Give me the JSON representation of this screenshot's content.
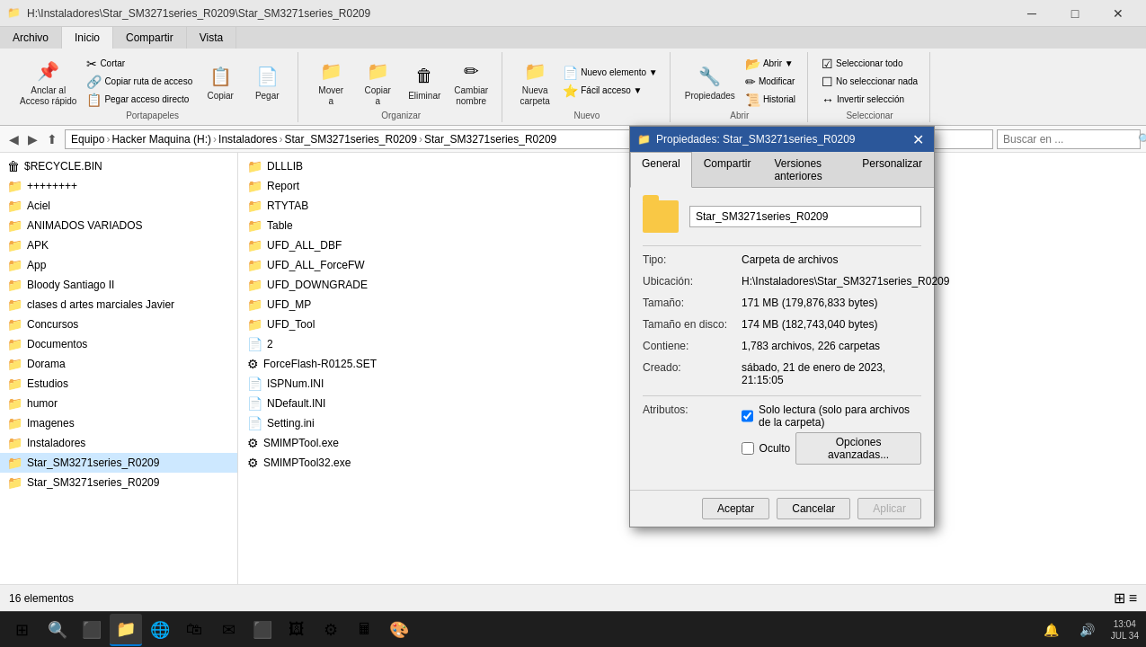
{
  "titleBar": {
    "text": "H:\\Instaladores\\Star_SM3271series_R0209\\Star_SM3271series_R0209",
    "minBtn": "─",
    "maxBtn": "□",
    "closeBtn": "✕"
  },
  "ribbon": {
    "tabs": [
      "Archivo",
      "Inicio",
      "Compartir",
      "Vista"
    ],
    "activeTab": "Inicio",
    "groups": {
      "portapapeles": {
        "label": "Portapapeles",
        "buttons": [
          {
            "icon": "📌",
            "label": "Anclar al\nAcceso rápido"
          },
          {
            "icon": "📋",
            "label": "Copiar"
          },
          {
            "icon": "📄",
            "label": "Pegar"
          },
          {
            "subItems": [
              "Cortar",
              "Copiar ruta de acceso",
              "Pegar acceso directo"
            ]
          }
        ]
      },
      "organizar": {
        "label": "Organizar",
        "buttons": [
          {
            "icon": "📁",
            "label": "Mover\na"
          },
          {
            "icon": "📁",
            "label": "Copiar\na"
          },
          {
            "icon": "🗑",
            "label": "Eliminar"
          },
          {
            "icon": "✏",
            "label": "Cambiar\nnombre"
          }
        ]
      },
      "nuevo": {
        "label": "Nuevo",
        "buttons": [
          {
            "icon": "📁",
            "label": "Nueva\ncarpeta"
          },
          {
            "icon": "📄",
            "label": "Nuevo elemento ▼"
          },
          {
            "icon": "⭐",
            "label": "Fácil acceso ▼"
          }
        ]
      },
      "abrir": {
        "label": "Abrir",
        "buttons": [
          {
            "icon": "📂",
            "label": "Abrir ▼"
          },
          {
            "icon": "✏",
            "label": "Modificar"
          },
          {
            "icon": "📜",
            "label": "Historial"
          },
          {
            "icon": "🔧",
            "label": "Propiedades"
          }
        ]
      },
      "seleccionar": {
        "label": "Seleccionar",
        "buttons": [
          {
            "icon": "☑",
            "label": "Seleccionar todo"
          },
          {
            "icon": "☐",
            "label": "No seleccionar nada"
          },
          {
            "icon": "↔",
            "label": "Invertir selección"
          }
        ]
      }
    }
  },
  "breadcrumb": {
    "backBtn": "◀",
    "forwardBtn": "▶",
    "upBtn": "⬆",
    "path": [
      "Equipo",
      "Hacker Maquina (H:)",
      "Instaladores",
      "Star_SM3271series_R0209",
      "Star_SM3271series_R0209"
    ],
    "searchPlaceholder": "Buscar en ..."
  },
  "sidebar": {
    "items": [
      {
        "label": "$RECYCLE.BIN",
        "type": "folder",
        "icon": "🗑"
      },
      {
        "label": "++++++++",
        "type": "folder",
        "icon": "📁"
      },
      {
        "label": "Aciel",
        "type": "folder",
        "icon": "📁"
      },
      {
        "label": "ANIMADOS VARIADOS",
        "type": "folder",
        "icon": "📁"
      },
      {
        "label": "APK",
        "type": "folder",
        "icon": "📁"
      },
      {
        "label": "App",
        "type": "folder",
        "icon": "📁"
      },
      {
        "label": "Bloody Santiago II",
        "type": "folder",
        "icon": "📁"
      },
      {
        "label": "clases d artes marciales Javier",
        "type": "folder",
        "icon": "📁"
      },
      {
        "label": "Concursos",
        "type": "folder",
        "icon": "📁"
      },
      {
        "label": "Documentos",
        "type": "folder",
        "icon": "📁"
      },
      {
        "label": "Dorama",
        "type": "folder",
        "icon": "📁"
      },
      {
        "label": "Estudios",
        "type": "folder",
        "icon": "📁"
      },
      {
        "label": "humor",
        "type": "folder",
        "icon": "📁"
      },
      {
        "label": "Imagenes",
        "type": "folder",
        "icon": "📁"
      },
      {
        "label": "Instaladores",
        "type": "folder",
        "icon": "📁"
      },
      {
        "label": "Star_SM3271series_R0209",
        "type": "folder",
        "icon": "📁",
        "selected": true
      },
      {
        "label": "Star_SM3271series_R0209",
        "type": "folder",
        "icon": "📁"
      }
    ]
  },
  "fileList": {
    "items": [
      {
        "name": "DLLLIB",
        "type": "folder",
        "icon": "📁"
      },
      {
        "name": "Report",
        "type": "folder",
        "icon": "📁"
      },
      {
        "name": "RTYTAB",
        "type": "folder",
        "icon": "📁"
      },
      {
        "name": "Table",
        "type": "folder",
        "icon": "📁"
      },
      {
        "name": "UFD_ALL_DBF",
        "type": "folder",
        "icon": "📁"
      },
      {
        "name": "UFD_ALL_ForceFW",
        "type": "folder",
        "icon": "📁"
      },
      {
        "name": "UFD_DOWNGRADE",
        "type": "folder",
        "icon": "📁"
      },
      {
        "name": "UFD_MP",
        "type": "folder",
        "icon": "📁"
      },
      {
        "name": "UFD_Tool",
        "type": "folder",
        "icon": "📁"
      },
      {
        "name": "2",
        "type": "file",
        "icon": "📄"
      },
      {
        "name": "ForceFlash-R0125.SET",
        "type": "file",
        "icon": "⚙"
      },
      {
        "name": "ISPNum.INI",
        "type": "file",
        "icon": "📄"
      },
      {
        "name": "NDefault.INI",
        "type": "file",
        "icon": "📄"
      },
      {
        "name": "Setting.ini",
        "type": "file",
        "icon": "📄"
      },
      {
        "name": "SMIMPTool.exe",
        "type": "exe",
        "icon": "⚙"
      },
      {
        "name": "SMIMPTool32.exe",
        "type": "exe",
        "icon": "⚙"
      }
    ]
  },
  "statusBar": {
    "itemCount": "16 elementos"
  },
  "dialog": {
    "title": "Propiedades: Star_SM3271series_R0209",
    "tabs": [
      "General",
      "Compartir",
      "Versiones anteriores",
      "Personalizar"
    ],
    "activeTab": "General",
    "folderName": "Star_SM3271series_R0209",
    "properties": [
      {
        "label": "Tipo:",
        "value": "Carpeta de archivos"
      },
      {
        "label": "Ubicación:",
        "value": "H:\\Instaladores\\Star_SM3271series_R0209"
      },
      {
        "label": "Tamaño:",
        "value": "171 MB (179,876,833 bytes)"
      },
      {
        "label": "Tamaño en disco:",
        "value": "174 MB (182,743,040 bytes)"
      },
      {
        "label": "Contiene:",
        "value": "1,783 archivos, 226 carpetas"
      },
      {
        "label": "Creado:",
        "value": "sábado, 21 de enero de 2023, 21:15:05"
      }
    ],
    "attributes": {
      "label": "Atributos:",
      "readOnly": {
        "checked": true,
        "label": "Solo lectura (solo para archivos de la carpeta)"
      },
      "hidden": {
        "checked": false,
        "label": "Oculto"
      },
      "advancedBtn": "Opciones avanzadas..."
    },
    "footer": {
      "aceptar": "Aceptar",
      "cancelar": "Cancelar",
      "aplicar": "Aplicar"
    }
  },
  "taskbar": {
    "startIcon": "⊞",
    "apps": [
      {
        "icon": "📁",
        "active": true
      },
      {
        "icon": "🖊"
      },
      {
        "icon": "🌐"
      },
      {
        "icon": "🗂"
      },
      {
        "icon": "📊"
      },
      {
        "icon": "🔧"
      },
      {
        "icon": "❓"
      },
      {
        "icon": "📧"
      },
      {
        "icon": "🎮"
      },
      {
        "icon": "🛡"
      },
      {
        "icon": "🎵"
      },
      {
        "icon": "📷"
      }
    ],
    "clock": {
      "time": "13:04",
      "date": "JUL",
      "year": "34"
    }
  }
}
